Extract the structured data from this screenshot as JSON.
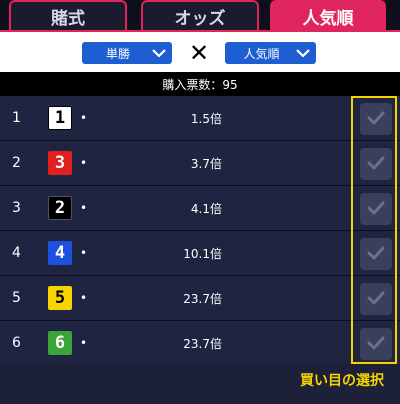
{
  "tabs": [
    {
      "label": "賭式",
      "active": false
    },
    {
      "label": "オッズ",
      "active": false
    },
    {
      "label": "人気順",
      "active": true
    }
  ],
  "selector": {
    "left": {
      "label": "単勝",
      "icon": "chevron-down-icon"
    },
    "separator": "✕",
    "right": {
      "label": "人気順",
      "icon": "chevron-down-icon"
    }
  },
  "ticket_count": "購入票数：95",
  "rows": [
    {
      "rank": "1",
      "number": "1",
      "dot": "•",
      "odds": "1.5倍",
      "box_bg": "#ffffff",
      "box_fg": "#000000",
      "box_border": "#000000"
    },
    {
      "rank": "2",
      "number": "3",
      "dot": "•",
      "odds": "3.7倍",
      "box_bg": "#e02020",
      "box_fg": "#ffffff",
      "box_border": "#e02020"
    },
    {
      "rank": "3",
      "number": "2",
      "dot": "•",
      "odds": "4.1倍",
      "box_bg": "#000000",
      "box_fg": "#ffffff",
      "box_border": "#555555"
    },
    {
      "rank": "4",
      "number": "4",
      "dot": "•",
      "odds": "10.1倍",
      "box_bg": "#1d4fe0",
      "box_fg": "#ffffff",
      "box_border": "#1d4fe0"
    },
    {
      "rank": "5",
      "number": "5",
      "dot": "•",
      "odds": "23.7倍",
      "box_bg": "#f5d400",
      "box_fg": "#000000",
      "box_border": "#f5d400"
    },
    {
      "rank": "6",
      "number": "6",
      "dot": "•",
      "odds": "23.7倍",
      "box_bg": "#3aa33a",
      "box_fg": "#ffffff",
      "box_border": "#3aa33a"
    }
  ],
  "hint": "買い目の選択",
  "colors": {
    "accent": "#e0245e",
    "highlight": "#f5d400",
    "dropdown": "#1d5fd3"
  }
}
